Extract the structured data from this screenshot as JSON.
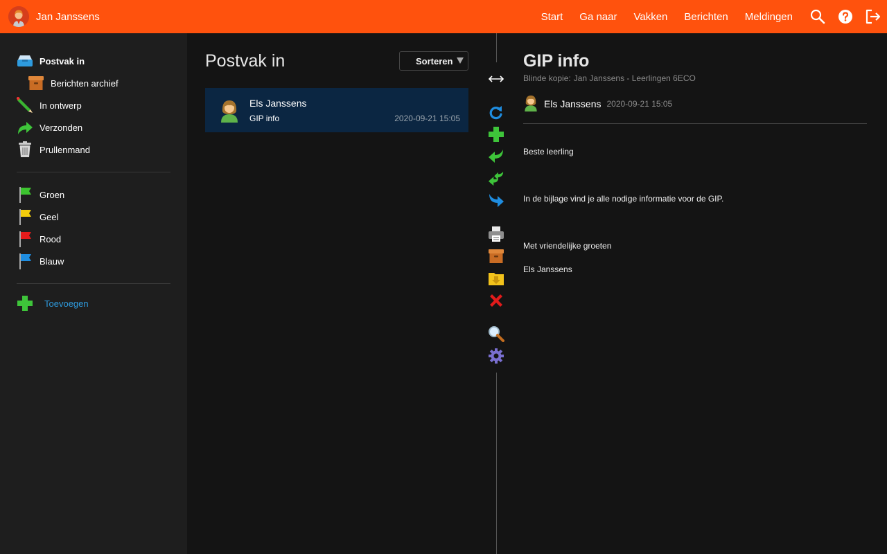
{
  "topbar": {
    "user_name": "Jan Janssens",
    "nav": [
      "Start",
      "Ga naar",
      "Vakken",
      "Berichten",
      "Meldingen"
    ],
    "icons": [
      "search-icon",
      "help-icon",
      "logout-icon"
    ],
    "color": "#ff520d"
  },
  "sidebar": {
    "folders": [
      {
        "label": "Postvak in",
        "icon": "inbox-icon",
        "active": true
      },
      {
        "label": "Berichten archief",
        "icon": "archive-box-icon"
      },
      {
        "label": "In ontwerp",
        "icon": "pencil-icon"
      },
      {
        "label": "Verzonden",
        "icon": "sent-arrow-icon"
      },
      {
        "label": "Prullenmand",
        "icon": "trash-icon"
      }
    ],
    "flags": [
      {
        "label": "Groen",
        "color": "#3cc42f"
      },
      {
        "label": "Geel",
        "color": "#f2cc0c"
      },
      {
        "label": "Rood",
        "color": "#e21b1b"
      },
      {
        "label": "Blauw",
        "color": "#1f8de0"
      }
    ],
    "add_label": "Toevoegen"
  },
  "list": {
    "title": "Postvak in",
    "sort_label": "Sorteren",
    "messages": [
      {
        "from": "Els Janssens",
        "subject": "GIP info",
        "date": "2020-09-21 15:05",
        "selected": true
      }
    ]
  },
  "toolbar": {
    "icons": [
      "expand-icon",
      "refresh-icon",
      "new-message-icon",
      "reply-icon",
      "reply-all-icon",
      "forward-icon",
      "print-icon",
      "archive-icon",
      "move-to-folder-icon",
      "delete-icon",
      "search-icon",
      "settings-icon"
    ]
  },
  "reading": {
    "title": "GIP info",
    "bcc_label": "Blinde kopie:",
    "bcc_value": "Jan Janssens - Leerlingen 6ECO",
    "sender": "Els Janssens",
    "date": "2020-09-21 15:05",
    "body": [
      "Beste leerling",
      "In de bijlage vind je alle nodige informatie voor de GIP.",
      "Met vriendelijke groeten",
      "Els Janssens"
    ]
  }
}
